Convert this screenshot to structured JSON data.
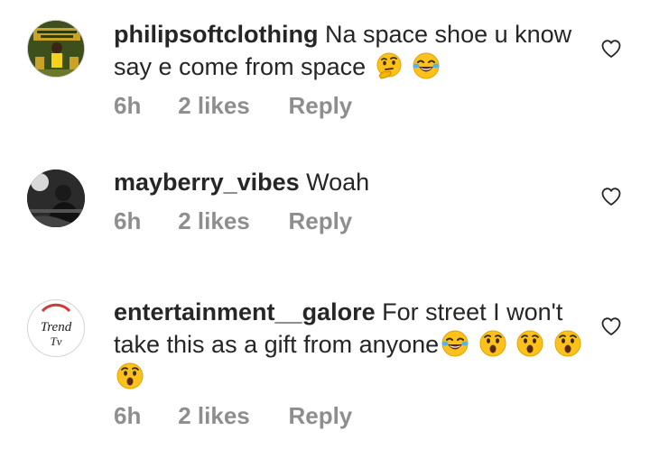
{
  "comments": [
    {
      "username": "philipsoftclothing",
      "text": "Na space shoe u know say e come from space",
      "emojis": [
        "thinking-face",
        "face-with-tears-of-joy"
      ],
      "time": "6h",
      "likes": "2 likes",
      "reply": "Reply",
      "avatar": "philipsoftclothing-avatar"
    },
    {
      "username": "mayberry_vibes",
      "text": "Woah",
      "emojis": [],
      "time": "6h",
      "likes": "2 likes",
      "reply": "Reply",
      "avatar": "mayberry-vibes-avatar"
    },
    {
      "username": "entertainment__galore",
      "text": "For street I won't take this as a gift from anyone",
      "emojis": [
        "face-with-tears-of-joy",
        "hushed-face",
        "hushed-face",
        "hushed-face",
        "hushed-face"
      ],
      "avatar_text": [
        "Trend",
        "Tv"
      ],
      "time": "6h",
      "likes": "2 likes",
      "reply": "Reply",
      "avatar": "trend-tv-avatar"
    }
  ],
  "colors": {
    "text": "#262626",
    "meta": "#8e8e8e",
    "emoji_yellow": "#fcc21b"
  },
  "icons": [
    "heart-outline-icon"
  ]
}
